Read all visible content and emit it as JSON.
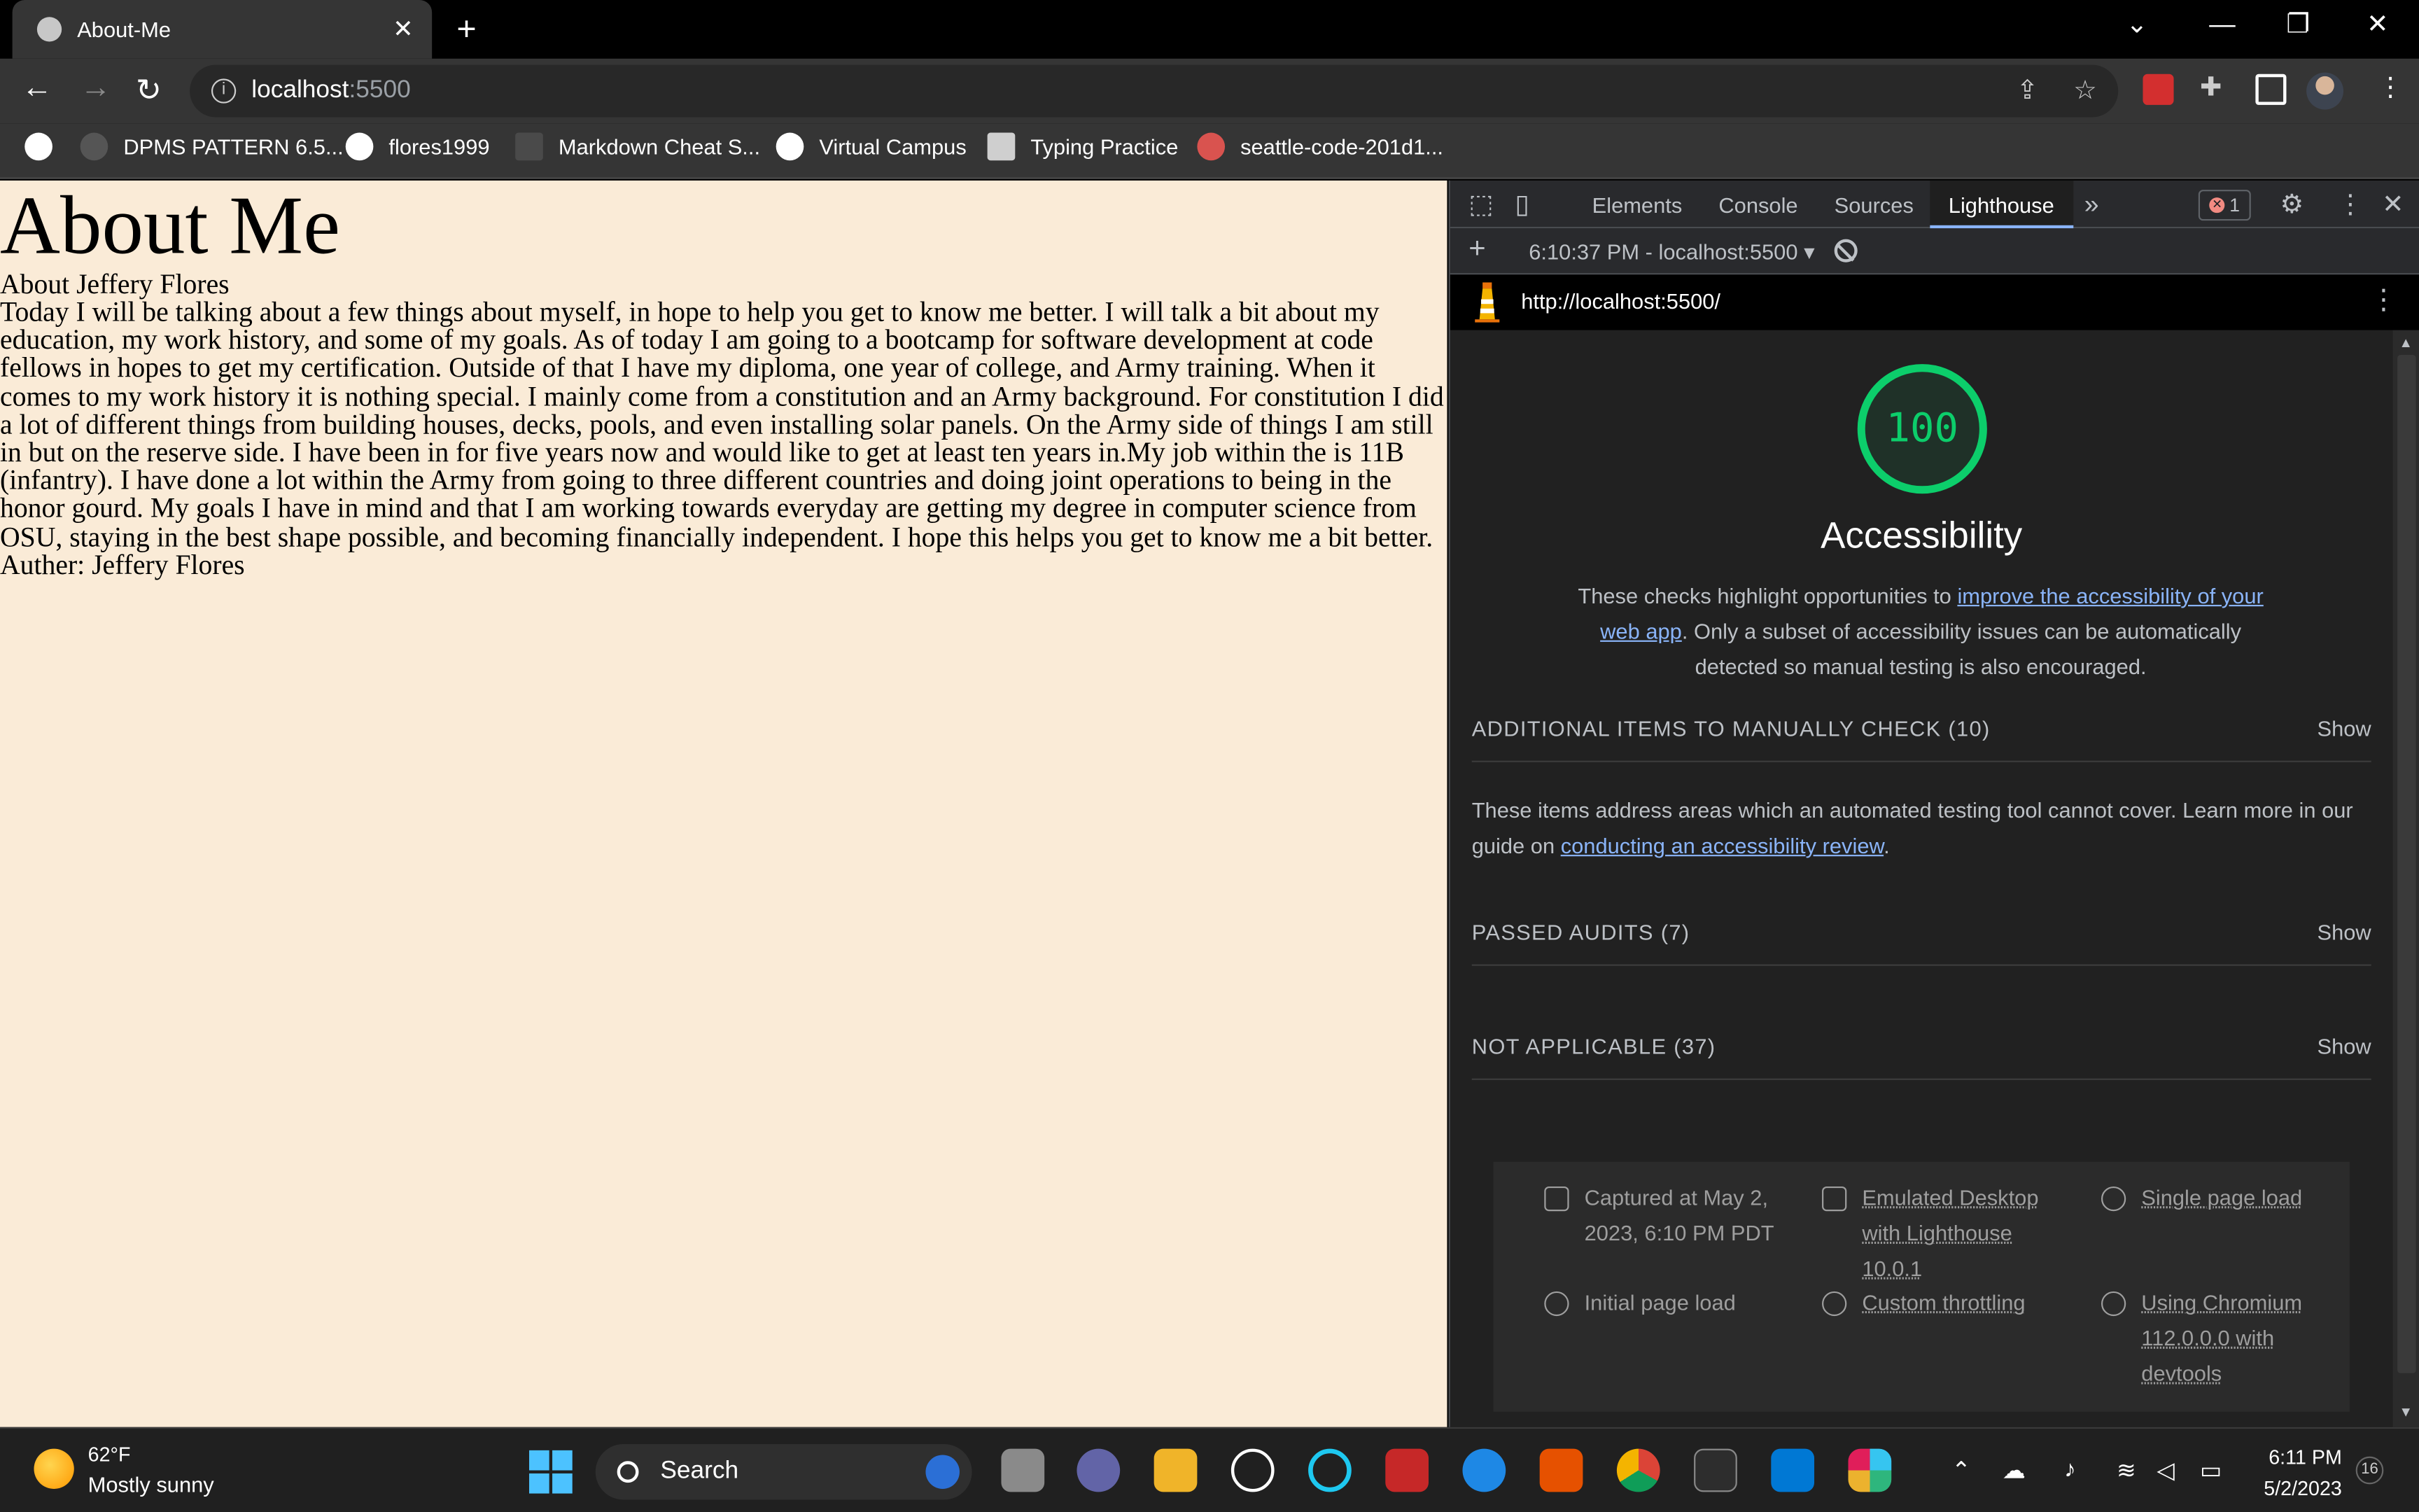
{
  "browser": {
    "tab_title": "About-Me",
    "tab_close": "✕",
    "new_tab": "+",
    "url_host": "localhost",
    "url_port": ":5500",
    "bookmarks": [
      {
        "label": "DPMS PATTERN 6.5...",
        "color": "#555555"
      },
      {
        "label": "flores1999",
        "color": "#ffffff"
      },
      {
        "label": "Markdown Cheat S...",
        "color": "#4a4a4a"
      },
      {
        "label": "Virtual Campus",
        "color": "#ffffff"
      },
      {
        "label": "Typing Practice",
        "color": "#cfcfcf"
      },
      {
        "label": "seattle-code-201d1...",
        "color": "#d9534f"
      }
    ]
  },
  "page": {
    "heading": "About Me",
    "subheading": "About Jeffery Flores",
    "body": "Today I will be talking about a few things about myself, in hope to help you get to know me better. I will talk a bit about my education, my work history, and some of my goals. As of today I am going to a bootcamp for software development at code fellows in hopes to get my certification. Outside of that I have my diploma, one year of college, and Army training. When it comes to my work history it is nothing special. I mainly come from a constitution and an Army background. For constitution I did a lot of different things from building houses, decks, pools, and even installing solar panels. On the Army side of things I am still in but on the reserve side. I have been in for five years now and would like to get at least ten years in.My job within the is 11B (infantry). I have done a lot within the Army from going to three different countries and doing joint operations to being in the honor gourd. My goals I have in mind and that I am working towards everyday are getting my degree in computer science from OSU, staying in the best shape possible, and becoming financially independent. I hope this helps you get to know me a bit better.",
    "author": "Auther: Jeffery Flores"
  },
  "devtools": {
    "tabs": [
      "Elements",
      "Console",
      "Sources",
      "Lighthouse"
    ],
    "active_tab": "Lighthouse",
    "more_tabs": "»",
    "error_count": "1",
    "report_selector": "6:10:37 PM - localhost:5500 ▾",
    "report_url": "http://localhost:5500/",
    "score": "100",
    "category_title": "Accessibility",
    "desc_before": "These checks highlight opportunities to ",
    "desc_link": "improve the accessibility of your web app",
    "desc_after": ". Only a subset of accessibility issues can be automatically detected so manual testing is also encouraged.",
    "groups": [
      {
        "title": "ADDITIONAL ITEMS TO MANUALLY CHECK (10)",
        "action": "Show"
      },
      {
        "title": "PASSED AUDITS (7)",
        "action": "Show"
      },
      {
        "title": "NOT APPLICABLE (37)",
        "action": "Show"
      }
    ],
    "manual_desc_before": "These items address areas which an automated testing tool cannot cover. Learn more in our guide on ",
    "manual_desc_link": "conducting an accessibility review",
    "manual_desc_after": ".",
    "meta": {
      "captured": "Captured at May 2, 2023, 6:10 PM PDT",
      "emulated": "Emulated Desktop with Lighthouse 10.0.1",
      "single": "Single page load",
      "initial": "Initial page load",
      "throttling": "Custom throttling",
      "chromium": "Using Chromium 112.0.0.0 with devtools"
    },
    "score_color": "#0cce6b"
  },
  "taskbar": {
    "temp": "62°F",
    "weather": "Mostly sunny",
    "search": "Search",
    "time": "6:11 PM",
    "date": "5/2/2023",
    "notifications": "16"
  }
}
